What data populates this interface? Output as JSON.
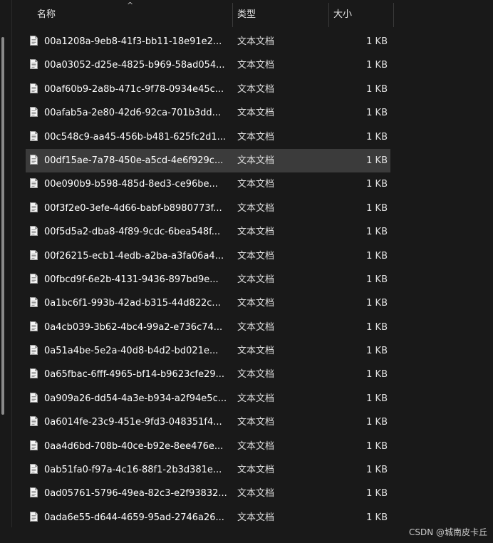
{
  "header": {
    "name_label": "名称",
    "type_label": "类型",
    "size_label": "大小"
  },
  "files": [
    {
      "name": "00a1208a-9eb8-41f3-bb11-18e91e2...",
      "type": "文本文档",
      "size": "1 KB"
    },
    {
      "name": "00a03052-d25e-4825-b969-58ad054...",
      "type": "文本文档",
      "size": "1 KB"
    },
    {
      "name": "00af60b9-2a8b-471c-9f78-0934e45c...",
      "type": "文本文档",
      "size": "1 KB"
    },
    {
      "name": "00afab5a-2e80-42d6-92ca-701b3dd...",
      "type": "文本文档",
      "size": "1 KB"
    },
    {
      "name": "00c548c9-aa45-456b-b481-625fc2d1...",
      "type": "文本文档",
      "size": "1 KB"
    },
    {
      "name": "00df15ae-7a78-450e-a5cd-4e6f929c...",
      "type": "文本文档",
      "size": "1 KB"
    },
    {
      "name": "00e090b9-b598-485d-8ed3-ce96be...",
      "type": "文本文档",
      "size": "1 KB"
    },
    {
      "name": "00f3f2e0-3efe-4d66-babf-b8980773f...",
      "type": "文本文档",
      "size": "1 KB"
    },
    {
      "name": "00f5d5a2-dba8-4f89-9cdc-6bea548f...",
      "type": "文本文档",
      "size": "1 KB"
    },
    {
      "name": "00f26215-ecb1-4edb-a2ba-a3fa06a4...",
      "type": "文本文档",
      "size": "1 KB"
    },
    {
      "name": "00fbcd9f-6e2b-4131-9436-897bd9e...",
      "type": "文本文档",
      "size": "1 KB"
    },
    {
      "name": "0a1bc6f1-993b-42ad-b315-44d822c...",
      "type": "文本文档",
      "size": "1 KB"
    },
    {
      "name": "0a4cb039-3b62-4bc4-99a2-e736c74...",
      "type": "文本文档",
      "size": "1 KB"
    },
    {
      "name": "0a51a4be-5e2a-40d8-b4d2-bd021e...",
      "type": "文本文档",
      "size": "1 KB"
    },
    {
      "name": "0a65fbac-6fff-4965-bf14-b9623cfe29...",
      "type": "文本文档",
      "size": "1 KB"
    },
    {
      "name": "0a909a26-dd54-4a3e-b934-a2f94e5c...",
      "type": "文本文档",
      "size": "1 KB"
    },
    {
      "name": "0a6014fe-23c9-451e-9fd3-048351f4...",
      "type": "文本文档",
      "size": "1 KB"
    },
    {
      "name": "0aa4d6bd-708b-40ce-b92e-8ee476e...",
      "type": "文本文档",
      "size": "1 KB"
    },
    {
      "name": "0ab51fa0-f97a-4c16-88f1-2b3d381e...",
      "type": "文本文档",
      "size": "1 KB"
    },
    {
      "name": "0ad05761-5796-49ea-82c3-e2f93832...",
      "type": "文本文档",
      "size": "1 KB"
    },
    {
      "name": "0ada6e55-d644-4659-95ad-2746a26...",
      "type": "文本文档",
      "size": "1 KB"
    }
  ],
  "selected_index": 5,
  "watermark": "CSDN @城南皮卡丘",
  "icons": {
    "file": "text-document-icon",
    "sort": "sort-ascending-icon"
  },
  "colors": {
    "background": "#191919",
    "selected_row": "#3b3b3b",
    "text": "#ffffff"
  }
}
